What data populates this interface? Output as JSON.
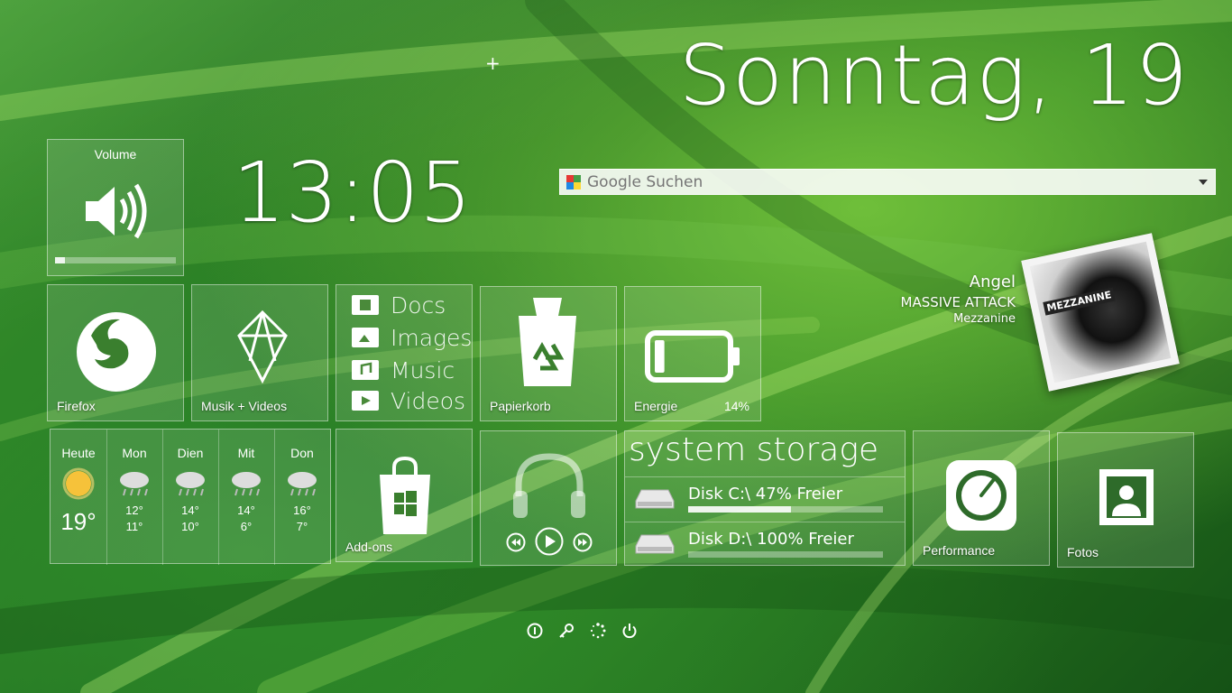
{
  "header": {
    "date": "Sonntag, 19",
    "time": "13:05"
  },
  "volume": {
    "label": "Volume",
    "level": 0.08
  },
  "search": {
    "placeholder": "Google Suchen"
  },
  "music_now_playing": {
    "title": "Angel",
    "artist": "MASSIVE ATTACK",
    "album": "Mezzanine",
    "cover_text": "MEZZANINE"
  },
  "tiles": {
    "firefox": "Firefox",
    "zune": "Musik + Videos",
    "recycle": "Papierkorb",
    "energy": "Energie",
    "energy_percent": "14%",
    "energy_level": 0.14,
    "addons": "Add-ons",
    "performance": "Performance",
    "photos": "Fotos"
  },
  "libraries": [
    {
      "label": "Docs",
      "icon": "document-folder-icon"
    },
    {
      "label": "Images",
      "icon": "image-folder-icon"
    },
    {
      "label": "Music",
      "icon": "music-folder-icon"
    },
    {
      "label": "Videos",
      "icon": "video-folder-icon"
    }
  ],
  "weather": {
    "today": {
      "day": "Heute",
      "temp": "19°"
    },
    "days": [
      {
        "day": "Mon",
        "hi": "12°",
        "lo": "11°"
      },
      {
        "day": "Dien",
        "hi": "14°",
        "lo": "10°"
      },
      {
        "day": "Mit",
        "hi": "14°",
        "lo": "6°"
      },
      {
        "day": "Don",
        "hi": "16°",
        "lo": "7°"
      }
    ]
  },
  "storage": {
    "title": "system storage",
    "disks": [
      {
        "label": "Disk C:\\ 47% Freier",
        "free": 0.47
      },
      {
        "label": "Disk D:\\ 100% Freier",
        "free": 1.0
      }
    ]
  },
  "colors": {
    "tile_border": "#ffffff",
    "accent_green": "#2e7d32"
  }
}
